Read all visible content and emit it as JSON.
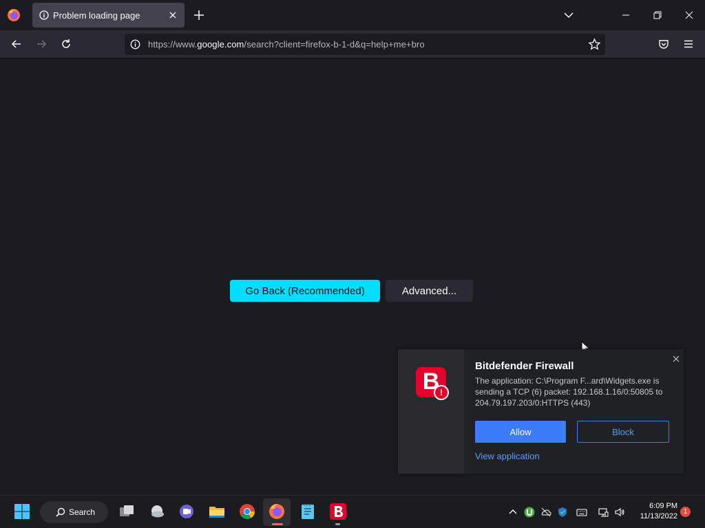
{
  "browser": {
    "tab": {
      "title": "Problem loading page"
    },
    "url": {
      "prefix": "https://www.",
      "domain": "google.com",
      "path": "/search?client=firefox-b-1-d&q=help+me+bro"
    }
  },
  "error_page": {
    "go_back_label": "Go Back (Recommended)",
    "advanced_label": "Advanced..."
  },
  "toast": {
    "title": "Bitdefender Firewall",
    "body": "The application: C:\\Program F...ard\\Widgets.exe is sending a TCP (6) packet: 192.168.1.16/0:50805 to 204.79.197.203/0:HTTPS (443)",
    "logo_letter": "B",
    "alert_mark": "!",
    "allow_label": "Allow",
    "block_label": "Block",
    "view_label": "View application"
  },
  "taskbar": {
    "search_label": "Search",
    "time": "6:09 PM",
    "date": "11/13/2022",
    "notification_count": "1",
    "apps": [
      "widgets-icon",
      "task-view-icon",
      "weather-icon",
      "teams-chat-icon",
      "file-explorer-icon",
      "chrome-icon",
      "firefox-icon",
      "notepad-icon",
      "bitdefender-icon"
    ]
  },
  "colors": {
    "accent_primary": "#00ddff",
    "bitdefender_red": "#e5002b",
    "allow_blue": "#3d7cf9"
  }
}
